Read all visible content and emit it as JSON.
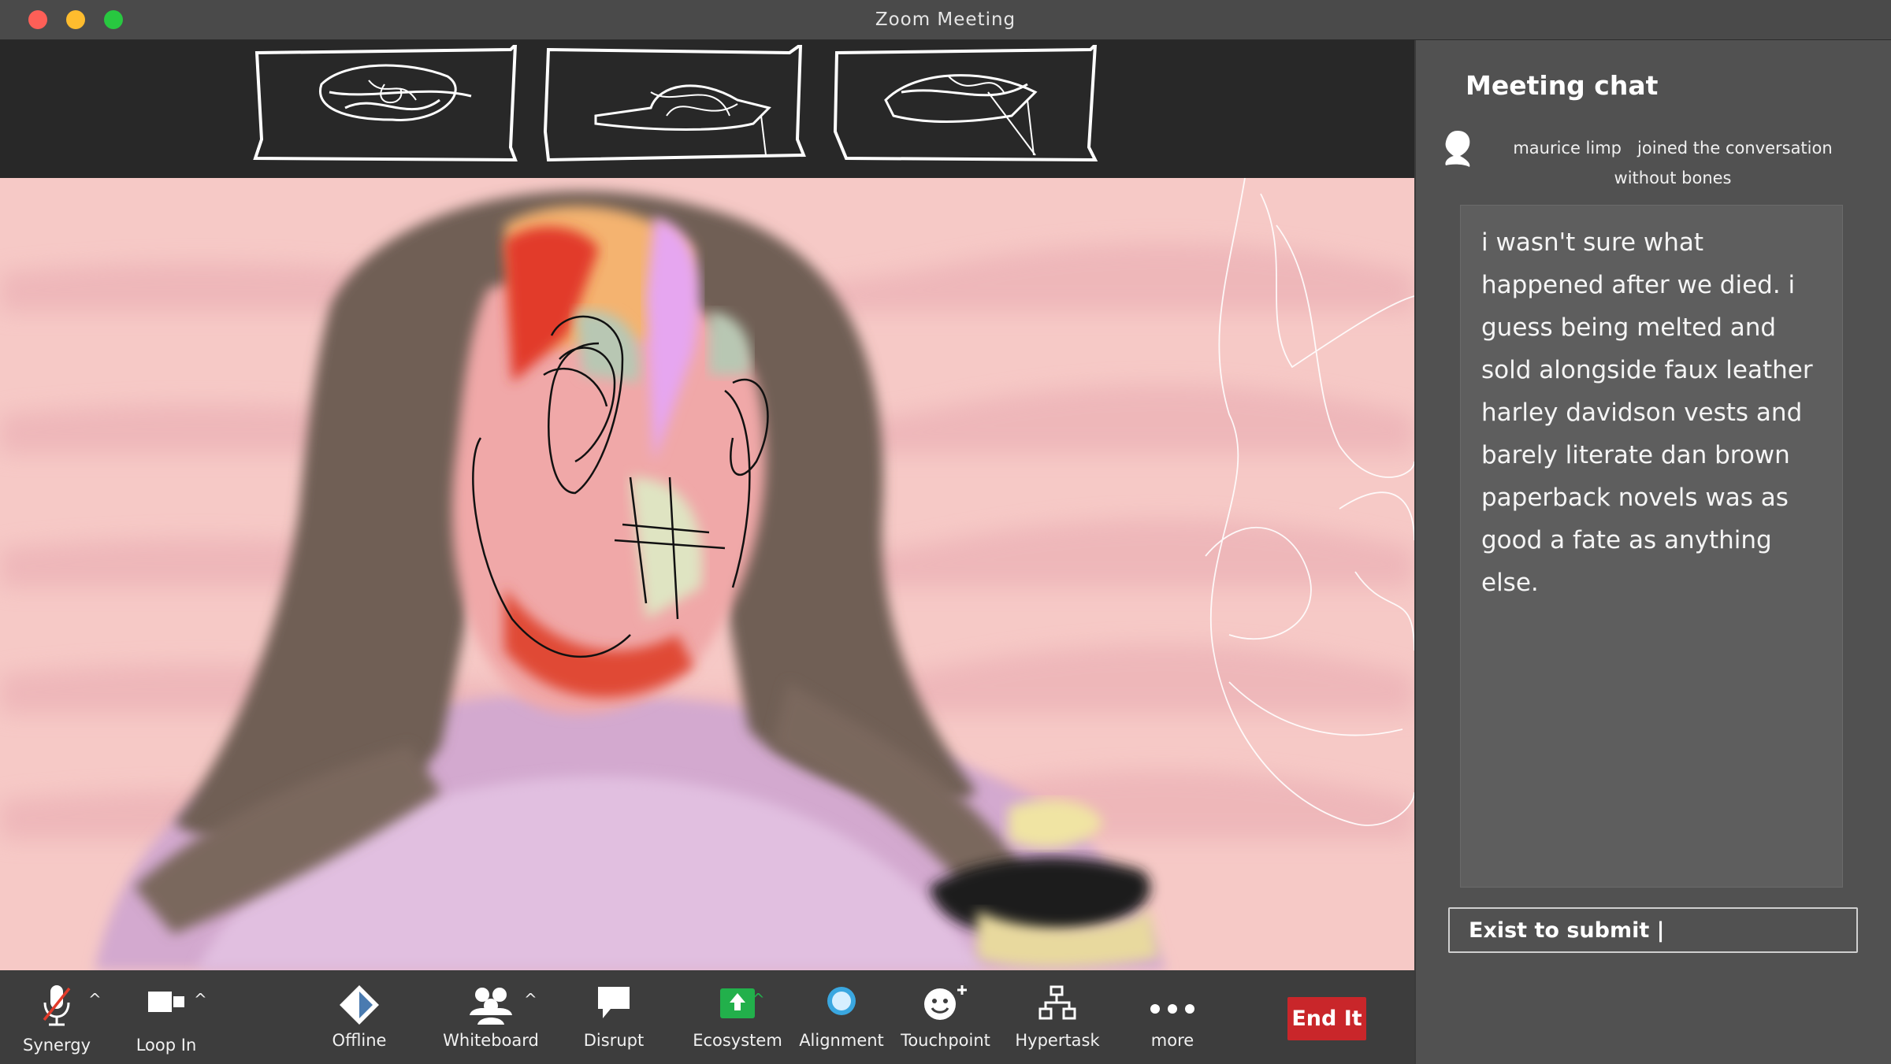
{
  "window": {
    "title": "Zoom Meeting"
  },
  "chat": {
    "title": "Meeting chat",
    "join_name": "maurice limp",
    "join_action": "joined the conversation",
    "join_suffix": "without bones",
    "message": "i wasn't sure what happened after we died. i guess being melted and sold alongside faux leather harley davidson vests and barely literate dan brown paperback novels was as good a fate as anything else.",
    "input_value": "Exist to submit |"
  },
  "toolbar": {
    "synergy": "Synergy",
    "loop_in": "Loop In",
    "offline": "Offline",
    "whiteboard": "Whiteboard",
    "disrupt": "Disrupt",
    "ecosystem": "Ecosystem",
    "alignment": "Alignment",
    "touchpoint": "Touchpoint",
    "hypertask": "Hypertask",
    "more": "more",
    "end": "End It"
  },
  "colors": {
    "end_button": "#c9262a",
    "ecosystem_icon": "#22b04b",
    "alignment_icon": "#3aa7e0",
    "video_background": "#f6c9c6"
  }
}
